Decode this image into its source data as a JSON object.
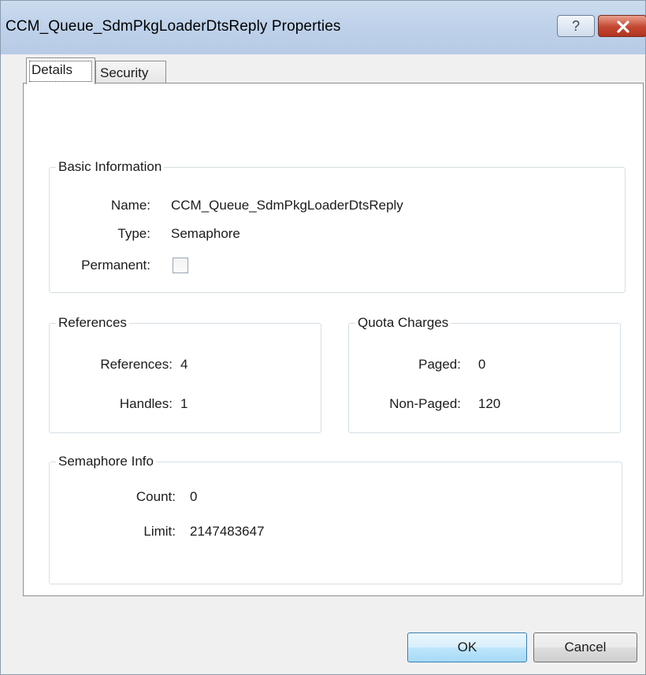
{
  "window": {
    "title": "CCM_Queue_SdmPkgLoaderDtsReply Properties",
    "help_label": "?",
    "close_icon": "close-icon"
  },
  "tabs": [
    {
      "label": "Details",
      "active": true
    },
    {
      "label": "Security",
      "active": false
    }
  ],
  "basic_information": {
    "title": "Basic Information",
    "name_label": "Name:",
    "name_value": "CCM_Queue_SdmPkgLoaderDtsReply",
    "type_label": "Type:",
    "type_value": "Semaphore",
    "permanent_label": "Permanent:",
    "permanent_checked": false
  },
  "references": {
    "title": "References",
    "references_label": "References:",
    "references_value": "4",
    "handles_label": "Handles:",
    "handles_value": "1"
  },
  "quota_charges": {
    "title": "Quota Charges",
    "paged_label": "Paged:",
    "paged_value": "0",
    "nonpaged_label": "Non-Paged:",
    "nonpaged_value": "120"
  },
  "semaphore_info": {
    "title": "Semaphore Info",
    "count_label": "Count:",
    "count_value": "0",
    "limit_label": "Limit:",
    "limit_value": "2147483647"
  },
  "buttons": {
    "ok_label": "OK",
    "cancel_label": "Cancel"
  },
  "colors": {
    "titlebar": "#bfd2ea",
    "close_button": "#c44731",
    "ok_button_border": "#3c7fb1",
    "group_border": "#d5dfe5"
  }
}
